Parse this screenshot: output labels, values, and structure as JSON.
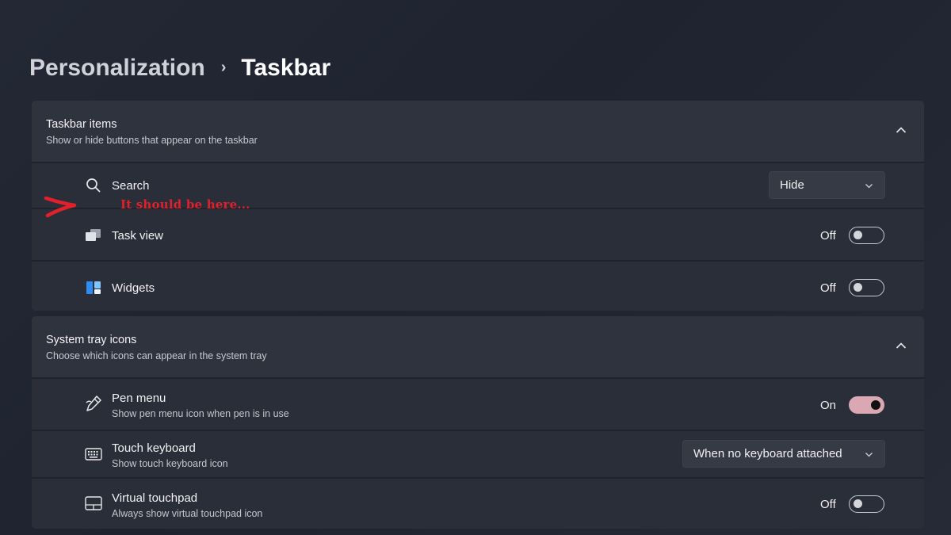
{
  "breadcrumb": {
    "parent": "Personalization",
    "separator": "›",
    "current": "Taskbar"
  },
  "taskbar_items": {
    "title": "Taskbar items",
    "subtitle": "Show or hide buttons that appear on the taskbar",
    "rows": [
      {
        "label": "Search",
        "icon": "search-icon",
        "control": "dropdown",
        "value": "Hide"
      },
      {
        "label": "Task view",
        "icon": "task-view-icon",
        "control": "toggle",
        "state": "Off"
      },
      {
        "label": "Widgets",
        "icon": "widgets-icon",
        "control": "toggle",
        "state": "Off"
      }
    ]
  },
  "system_tray": {
    "title": "System tray icons",
    "subtitle": "Choose which icons can appear in the system tray",
    "rows": [
      {
        "label": "Pen menu",
        "sublabel": "Show pen menu icon when pen is in use",
        "icon": "pen-icon",
        "control": "toggle",
        "state": "On"
      },
      {
        "label": "Touch keyboard",
        "sublabel": "Show touch keyboard icon",
        "icon": "keyboard-icon",
        "control": "dropdown",
        "value": "When no keyboard attached"
      },
      {
        "label": "Virtual touchpad",
        "sublabel": "Always show virtual touchpad icon",
        "icon": "touchpad-icon",
        "control": "toggle",
        "state": "Off"
      }
    ]
  },
  "annotation": {
    "text": "It should be here..."
  },
  "colors": {
    "toggle_on": "#d9a8b2",
    "annotation": "#e0202a"
  }
}
